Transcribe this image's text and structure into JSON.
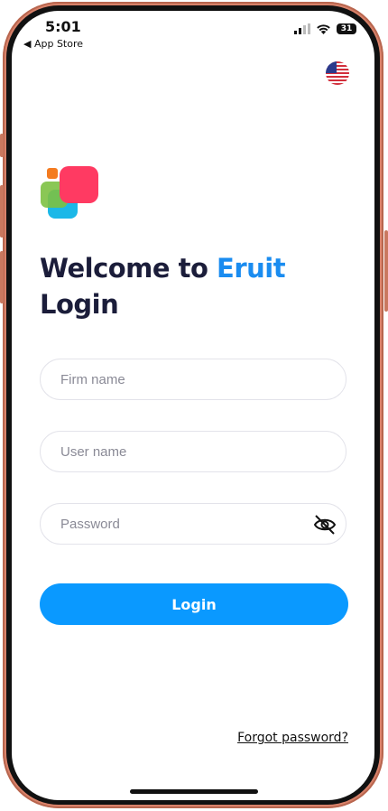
{
  "status_bar": {
    "time": "5:01",
    "back_app": "◀ App Store",
    "battery": "31"
  },
  "header": {
    "language_flag_icon": "us-flag-icon"
  },
  "brand": {
    "welcome_prefix": "Welcome to ",
    "brand_name": "Eruit",
    "subtitle": "Login",
    "brand_color": "#1a8cf0",
    "logo_colors": [
      "#ff3a62",
      "#f47b20",
      "#7dc142",
      "#1bb8e8"
    ]
  },
  "form": {
    "firm_placeholder": "Firm name",
    "user_placeholder": "User name",
    "password_placeholder": "Password",
    "password_toggle_icon": "eye-slash-icon",
    "login_label": "Login",
    "login_color": "#0a99ff"
  },
  "footer": {
    "forgot_label": "Forgot password?"
  }
}
